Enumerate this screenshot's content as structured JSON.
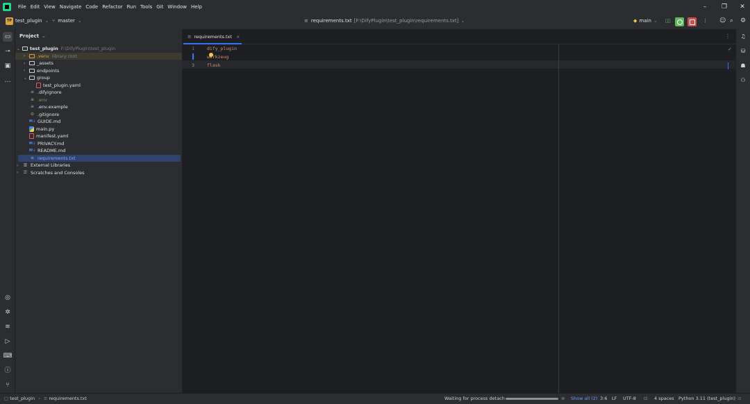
{
  "menu": [
    "File",
    "Edit",
    "View",
    "Navigate",
    "Code",
    "Refactor",
    "Run",
    "Tools",
    "Git",
    "Window",
    "Help"
  ],
  "toolbar": {
    "project_badge": "TP",
    "project_name": "test_plugin",
    "branch": "master",
    "file_title": "requirements.txt",
    "file_path": "[F:\\DifyPlugin\\test_plugin\\requirements.txt]",
    "run_config": "main"
  },
  "project_panel": {
    "title": "Project",
    "root_name": "test_plugin",
    "root_path": "F:\\DifyPlugin\\test_plugin",
    "items": [
      {
        "label": ".venv",
        "extra": "library root",
        "icon": "folder-icon"
      },
      {
        "label": "_assets",
        "icon": "folder-icon"
      },
      {
        "label": "endpoints",
        "icon": "folder-icon"
      },
      {
        "label": "group",
        "icon": "folder-icon"
      },
      {
        "label": "test_plugin.yaml",
        "icon": "yaml-file-icon"
      },
      {
        "label": ".difyignore",
        "icon": "text-file-icon"
      },
      {
        "label": ".env",
        "icon": "text-file-icon"
      },
      {
        "label": ".env.example",
        "icon": "text-file-icon"
      },
      {
        "label": ".gitignore",
        "icon": "ignore-file-icon"
      },
      {
        "label": "GUIDE.md",
        "icon": "markdown-file-icon"
      },
      {
        "label": "main.py",
        "icon": "python-file-icon"
      },
      {
        "label": "manifest.yaml",
        "icon": "yaml-file-icon"
      },
      {
        "label": "PRIVACY.md",
        "icon": "markdown-file-icon"
      },
      {
        "label": "README.md",
        "icon": "markdown-file-icon"
      },
      {
        "label": "requirements.txt",
        "icon": "text-file-icon"
      },
      {
        "label": "External Libraries",
        "icon": "library-icon"
      },
      {
        "label": "Scratches and Consoles",
        "icon": "scratches-icon"
      }
    ]
  },
  "editor": {
    "tab_label": "requirements.txt",
    "line_numbers": [
      "1",
      "2",
      "3"
    ],
    "lines": [
      "dify_plugin",
      "werkzeug",
      "flask"
    ]
  },
  "status": {
    "breadcrumb_project": "test_plugin",
    "breadcrumb_file": "requirements.txt",
    "process": "Waiting for process detach",
    "progress": 1.0,
    "show_all": "Show all (2)",
    "position": "3:6",
    "line_sep": "LF",
    "encoding": "UTF-8",
    "indent": "4 spaces",
    "interpreter": "Python 3.11 (test_plugin)"
  }
}
